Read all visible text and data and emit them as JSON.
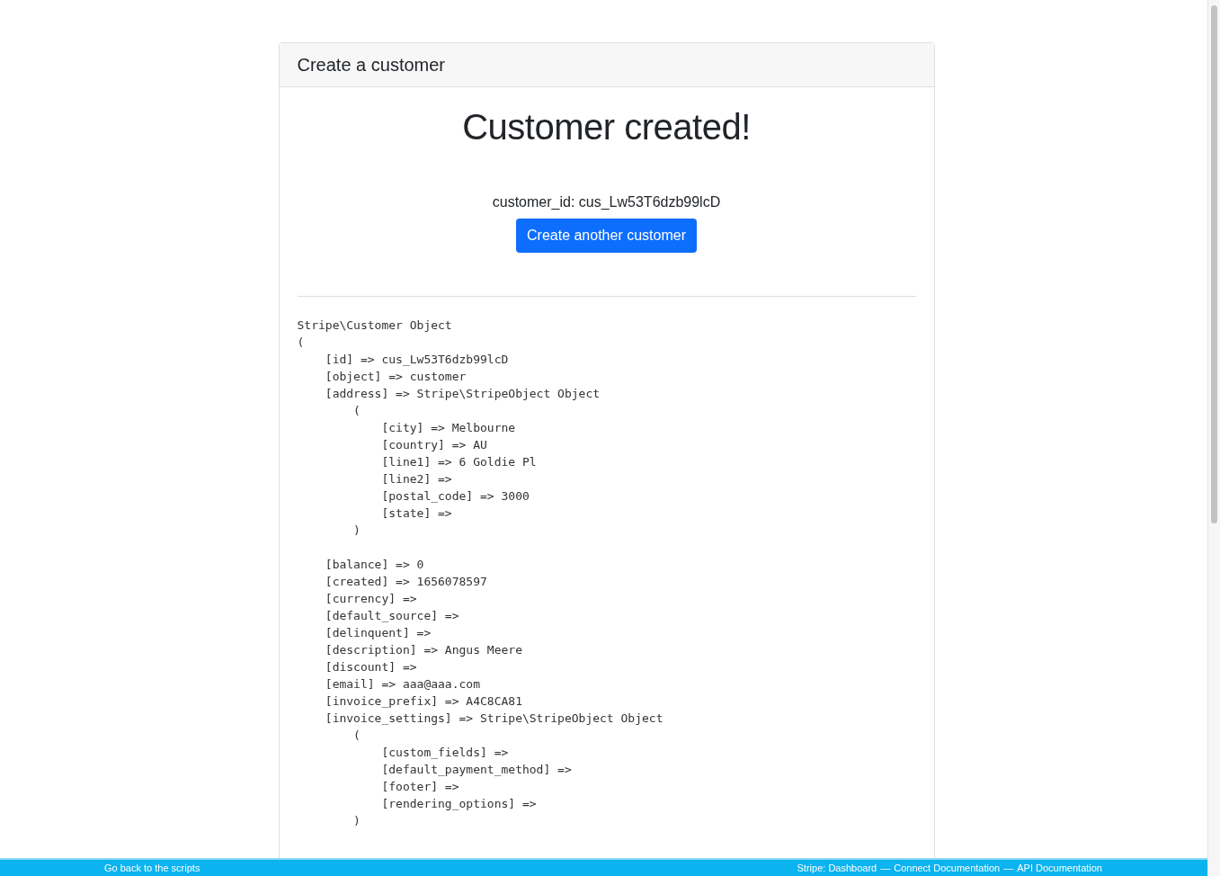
{
  "card": {
    "header": "Create a customer",
    "title": "Customer created!",
    "customer_id": "customer_id: cus_Lw53T6dzb99lcD",
    "button": "Create another customer",
    "dump": [
      [
        "Stripe\\Customer Object",
        "(",
        "    [id] => cus_Lw53T6dzb99lcD",
        "    [object] => customer",
        "    [address] => Stripe\\StripeObject Object",
        "        (",
        "            [city] => Melbourne",
        "            [country] => AU",
        "            [line1] => 6 Goldie Pl",
        "            [line2] => ",
        "            [postal_code] => 3000",
        "            [state] => ",
        "        )"
      ],
      [
        "    [balance] => 0",
        "    [created] => 1656078597",
        "    [currency] => ",
        "    [default_source] => ",
        "    [delinquent] => ",
        "    [description] => Angus Meere",
        "    [discount] => ",
        "    [email] => aaa@aaa.com",
        "    [invoice_prefix] => A4C8CA81",
        "    [invoice_settings] => Stripe\\StripeObject Object",
        "        (",
        "            [custom_fields] => ",
        "            [default_payment_method] => ",
        "            [footer] => ",
        "            [rendering_options] => ",
        "        )"
      ]
    ]
  },
  "footer": {
    "left": "Go back to the scripts",
    "right": [
      {
        "text": "Stripe: Dashboard"
      },
      {
        "text": "Connect Documentation"
      },
      {
        "text": "API Documentation"
      }
    ],
    "separator": "—"
  }
}
